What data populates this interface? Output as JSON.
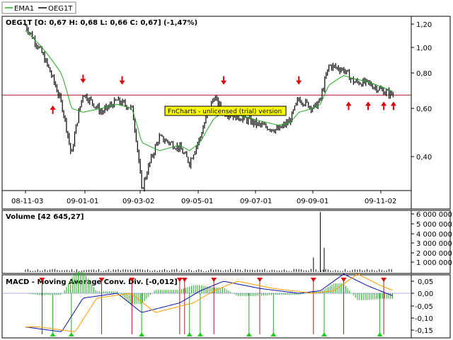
{
  "legend": {
    "items": [
      {
        "label": "EMA1",
        "color": "#22aa22"
      },
      {
        "label": "OEG1T",
        "color": "#000000"
      }
    ]
  },
  "price_panel": {
    "title": "OEG1T [O: 0,67  H: 0,68  L: 0,66  C: 0,67] (-1,47%)",
    "y_ticks": [
      "1,20",
      "1,00",
      "0,80",
      "0,60",
      "0,40"
    ],
    "x_ticks": [
      "08-11-03",
      "09-01-01",
      "09-03-02",
      "09-05-01",
      "09-07-01",
      "09-09-01",
      "09-11-02"
    ],
    "reference_line_color": "#a02020",
    "watermark": "FnCharts - unlicensed (trial) version"
  },
  "volume_panel": {
    "title": "Volume [42 645,27]",
    "y_ticks": [
      "6 000 000",
      "5 000 000",
      "4 000 000",
      "3 000 000",
      "2 000 000",
      "1 000 000"
    ]
  },
  "macd_panel": {
    "title": "MACD - Moving Average Conv. Div. [-0,012]",
    "y_ticks": [
      "0,05",
      "0,00",
      "-0,05",
      "-0,10",
      "-0,15"
    ]
  },
  "chart_data": [
    {
      "type": "line",
      "title": "OEG1T [O: 0,67  H: 0,68  L: 0,66  C: 0,67] (-1,47%)",
      "x": [
        "08-11-03",
        "08-11-20",
        "08-12-10",
        "08-12-20",
        "09-01-01",
        "09-01-20",
        "09-02-05",
        "09-02-20",
        "09-03-02",
        "09-03-20",
        "09-04-10",
        "09-04-20",
        "09-05-01",
        "09-05-15",
        "09-05-25",
        "09-06-15",
        "09-07-01",
        "09-07-20",
        "09-08-01",
        "09-08-10",
        "09-08-25",
        "09-09-01",
        "09-09-10",
        "09-09-25",
        "09-10-05",
        "09-10-20",
        "09-11-02",
        "09-11-15"
      ],
      "series": [
        {
          "name": "OEG1T",
          "values": [
            1.2,
            0.95,
            0.62,
            0.4,
            0.68,
            0.58,
            0.64,
            0.6,
            0.3,
            0.47,
            0.43,
            0.38,
            0.47,
            0.66,
            0.58,
            0.55,
            0.52,
            0.5,
            0.54,
            0.65,
            0.6,
            0.64,
            0.86,
            0.83,
            0.75,
            0.74,
            0.7,
            0.67
          ]
        },
        {
          "name": "EMA1",
          "values": [
            1.15,
            1.0,
            0.8,
            0.6,
            0.58,
            0.6,
            0.62,
            0.6,
            0.45,
            0.42,
            0.44,
            0.42,
            0.45,
            0.55,
            0.58,
            0.56,
            0.54,
            0.52,
            0.53,
            0.58,
            0.6,
            0.62,
            0.73,
            0.79,
            0.77,
            0.75,
            0.72,
            0.69
          ]
        }
      ],
      "ylim": [
        0.28,
        1.25
      ],
      "reference_line": 0.67,
      "scale": "log",
      "grid": false,
      "legend": "top-left"
    },
    {
      "type": "bar",
      "title": "Volume [42 645,27]",
      "x": [
        "09-08-25",
        "09-09-01",
        "09-09-05"
      ],
      "values": [
        1500000,
        6200000,
        2500000
      ],
      "ylim": [
        0,
        6500000
      ]
    },
    {
      "type": "line",
      "title": "MACD - Moving Average Conv. Div. [-0,012]",
      "x": [
        "08-11-03",
        "08-12-10",
        "09-01-01",
        "09-02-05",
        "09-03-02",
        "09-04-10",
        "09-05-01",
        "09-05-25",
        "09-07-01",
        "09-08-10",
        "09-09-01",
        "09-09-25",
        "09-10-20",
        "09-11-15"
      ],
      "values": [
        -0.14,
        -0.16,
        -0.02,
        0.0,
        -0.08,
        -0.04,
        0.01,
        0.05,
        0.02,
        0.0,
        0.01,
        0.08,
        0.03,
        -0.012
      ],
      "ylim": [
        -0.17,
        0.07
      ],
      "grid": false
    }
  ]
}
